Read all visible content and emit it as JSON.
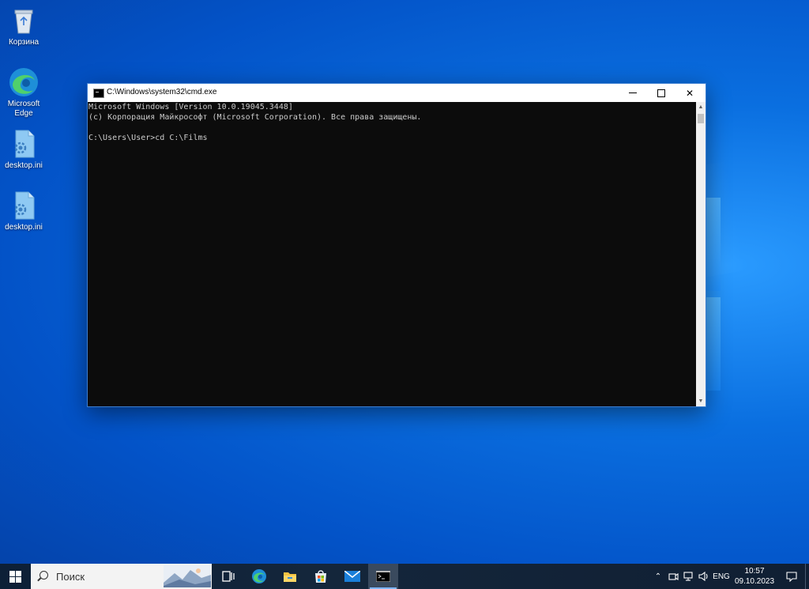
{
  "desktop": {
    "icons": [
      {
        "label": "Корзина",
        "icon": "recycle-bin-icon"
      },
      {
        "label": "Microsoft Edge",
        "icon": "edge-icon"
      },
      {
        "label": "desktop.ini",
        "icon": "settings-file-icon"
      },
      {
        "label": "desktop.ini",
        "icon": "settings-file-icon"
      }
    ]
  },
  "cmd_window": {
    "title": "C:\\Windows\\system32\\cmd.exe",
    "lines": [
      "Microsoft Windows [Version 10.0.19045.3448]",
      "(c) Корпорация Майкрософт (Microsoft Corporation). Все права защищены.",
      "",
      "C:\\Users\\User>cd C:\\Films"
    ],
    "controls": {
      "minimize": "—",
      "maximize": "☐",
      "close": "✕"
    }
  },
  "taskbar": {
    "search_placeholder": "Поиск",
    "apps": [
      "task-view-icon",
      "edge-icon",
      "file-explorer-icon",
      "store-icon",
      "mail-icon",
      "cmd-icon"
    ],
    "tray": {
      "language": "ENG",
      "time": "10:57",
      "date": "09.10.2023"
    }
  },
  "colors": {
    "console_bg": "#0c0c0c",
    "console_text": "#cccccc",
    "taskbar_bg": "#14263b",
    "desktop_blue": "#0a6fe0"
  }
}
